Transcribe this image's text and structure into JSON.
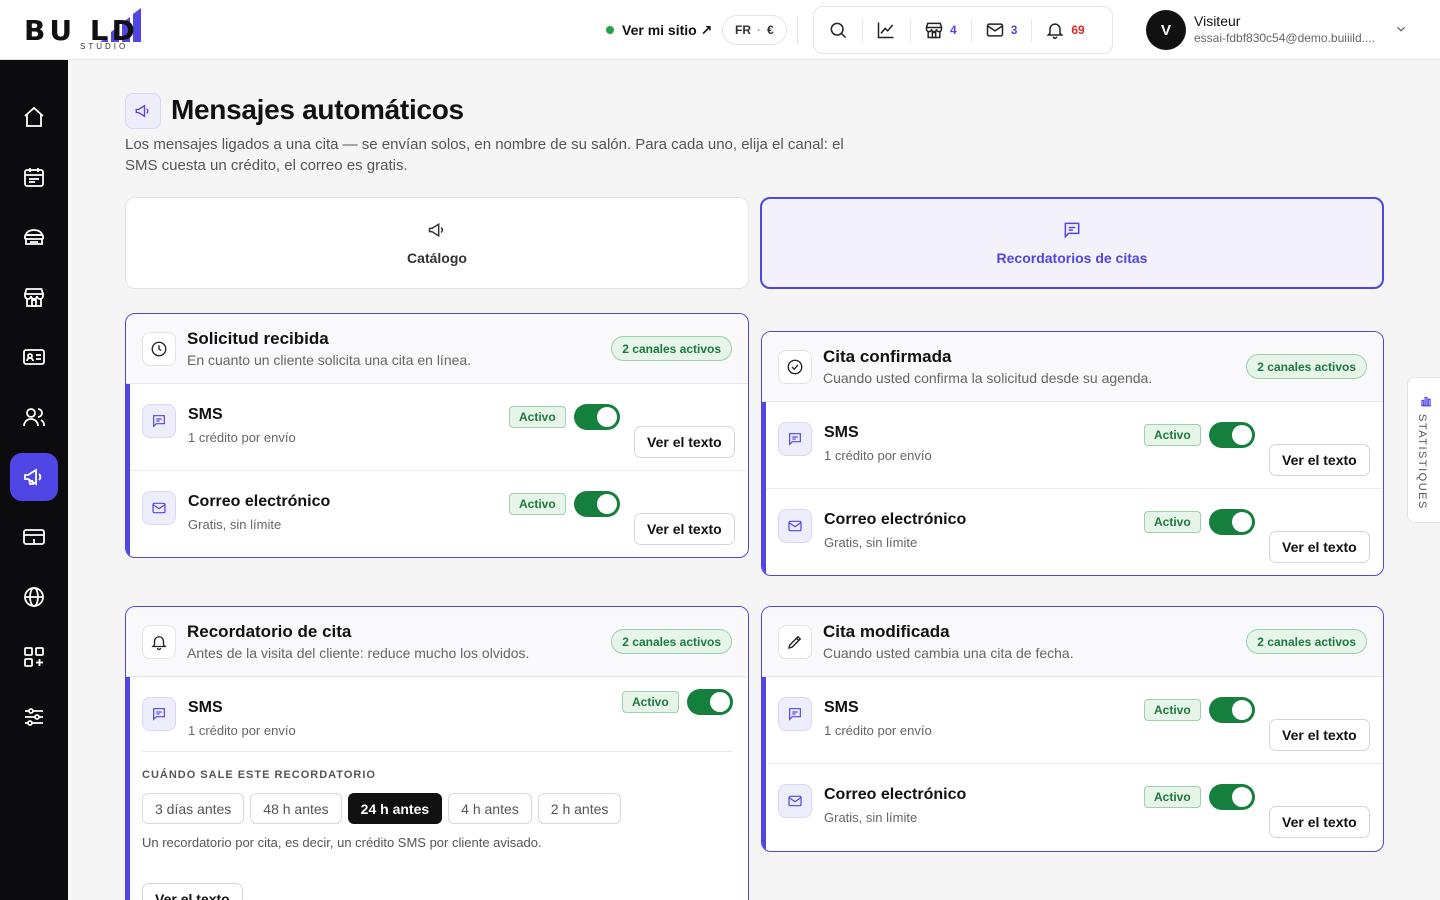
{
  "brand": {
    "logo_main": "BU  LD",
    "logo_sub": "STUDIO"
  },
  "topbar": {
    "site_link": "Ver mi sitio ↗",
    "lang": "FR",
    "currency": "€",
    "stores_count": "4",
    "mail_count": "3",
    "notif_count": "69",
    "user_initial": "V",
    "user_name": "Visiteur",
    "user_email": "essai-fdbf830c54@demo.buiiild...."
  },
  "sidebar": {
    "items": [
      "home",
      "calendar",
      "services",
      "store",
      "contacts",
      "clients",
      "messages",
      "payments",
      "website",
      "apps",
      "settings"
    ],
    "active": "messages"
  },
  "page": {
    "title": "Mensajes automáticos",
    "description": "Los mensajes ligados a una cita — se envían solos, en nombre de su salón. Para cada uno, elija el canal: el SMS cuesta un crédito, el correo es gratis."
  },
  "tabs": [
    {
      "label": "Catálogo",
      "active": false
    },
    {
      "label": "Recordatorios de citas",
      "active": true
    }
  ],
  "common": {
    "active_channels": "2 canales activos",
    "activo": "Activo",
    "view_text": "Ver el texto",
    "sms_name": "SMS",
    "sms_desc": "1 crédito por envío",
    "email_name": "Correo electrónico",
    "email_desc": "Gratis, sin límite"
  },
  "cards": {
    "solicitud": {
      "title": "Solicitud recibida",
      "subtitle": "En cuanto un cliente solicita una cita en línea."
    },
    "confirmada": {
      "title": "Cita confirmada",
      "subtitle": "Cuando usted confirma la solicitud desde su agenda."
    },
    "recordatorio": {
      "title": "Recordatorio de cita",
      "subtitle": "Antes de la visita del cliente: reduce mucho los olvidos.",
      "when_label": "CUÁNDO SALE ESTE RECORDATORIO",
      "options": [
        "3 días antes",
        "48 h antes",
        "24 h antes",
        "4 h antes",
        "2 h antes"
      ],
      "selected": "24 h antes",
      "note": "Un recordatorio por cita, es decir, un crédito SMS por cliente avisado."
    },
    "modificada": {
      "title": "Cita modificada",
      "subtitle": "Cuando usted cambia una cita de fecha."
    }
  },
  "stats_tab": "STATISTIQUES",
  "colors": {
    "accent": "#4f46e5",
    "success": "#15803d",
    "sidebar": "#0c0c0e",
    "alert": "#dc2626"
  }
}
